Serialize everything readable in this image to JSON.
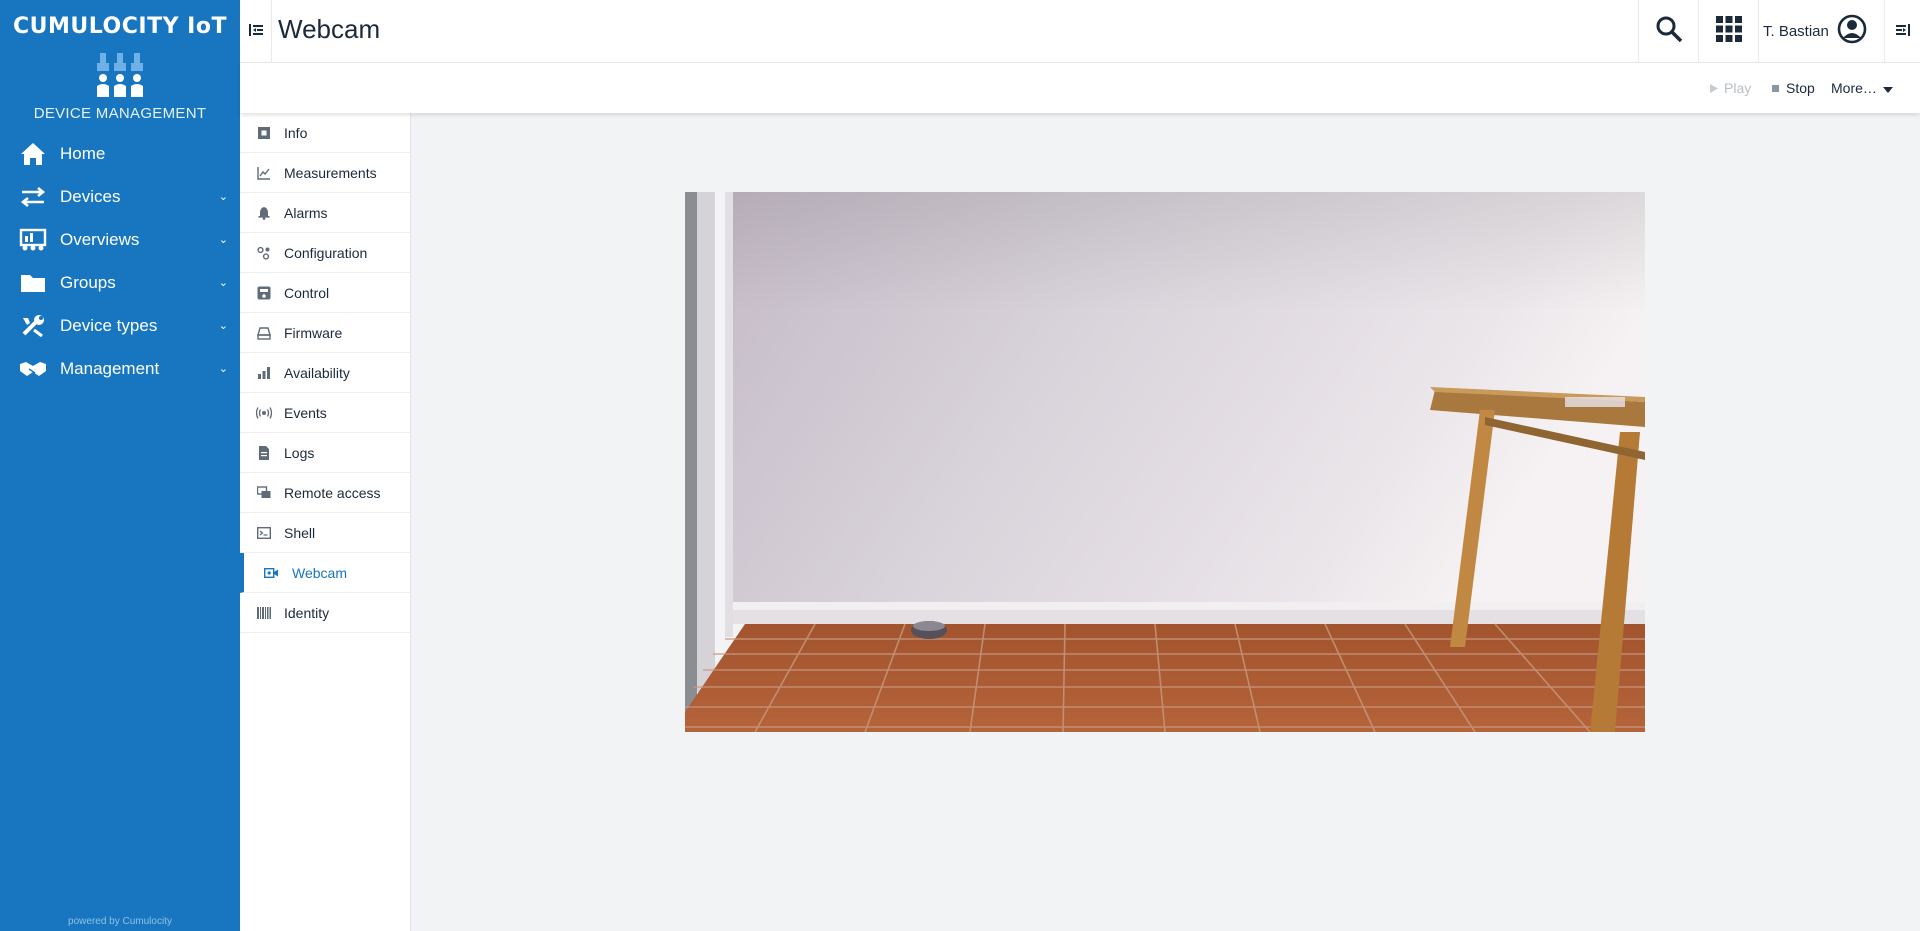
{
  "brand": {
    "title": "CUMULOCITY IoT",
    "subtitle": "DEVICE MANAGEMENT",
    "powered_by": "powered by Cumulocity"
  },
  "sidebar": {
    "items": [
      {
        "label": "Home",
        "icon": "home-icon",
        "expandable": false
      },
      {
        "label": "Devices",
        "icon": "exchange-icon",
        "expandable": true
      },
      {
        "label": "Overviews",
        "icon": "dashboard-icon",
        "expandable": true
      },
      {
        "label": "Groups",
        "icon": "folder-icon",
        "expandable": true
      },
      {
        "label": "Device types",
        "icon": "wrench-icon",
        "expandable": true
      },
      {
        "label": "Management",
        "icon": "handshake-icon",
        "expandable": true
      }
    ],
    "chevron": "⌄"
  },
  "header": {
    "title": "Webcam",
    "user_name": "T. Bastian"
  },
  "actions": {
    "play": "Play",
    "stop": "Stop",
    "more": "More…"
  },
  "tabs": [
    {
      "label": "Info",
      "icon": "info-icon",
      "active": false
    },
    {
      "label": "Measurements",
      "icon": "line-chart-icon",
      "active": false
    },
    {
      "label": "Alarms",
      "icon": "bell-icon",
      "active": false
    },
    {
      "label": "Configuration",
      "icon": "config-icon",
      "active": false
    },
    {
      "label": "Control",
      "icon": "control-icon",
      "active": false
    },
    {
      "label": "Firmware",
      "icon": "firmware-icon",
      "active": false
    },
    {
      "label": "Availability",
      "icon": "bar-chart-icon",
      "active": false
    },
    {
      "label": "Events",
      "icon": "broadcast-icon",
      "active": false
    },
    {
      "label": "Logs",
      "icon": "document-icon",
      "active": false
    },
    {
      "label": "Remote access",
      "icon": "remote-icon",
      "active": false
    },
    {
      "label": "Shell",
      "icon": "terminal-icon",
      "active": false
    },
    {
      "label": "Webcam",
      "icon": "video-camera-icon",
      "active": true
    },
    {
      "label": "Identity",
      "icon": "barcode-icon",
      "active": false
    }
  ],
  "colors": {
    "brand": "#1776bf",
    "background": "#f2f3f4",
    "text": "#1b2a3a"
  }
}
